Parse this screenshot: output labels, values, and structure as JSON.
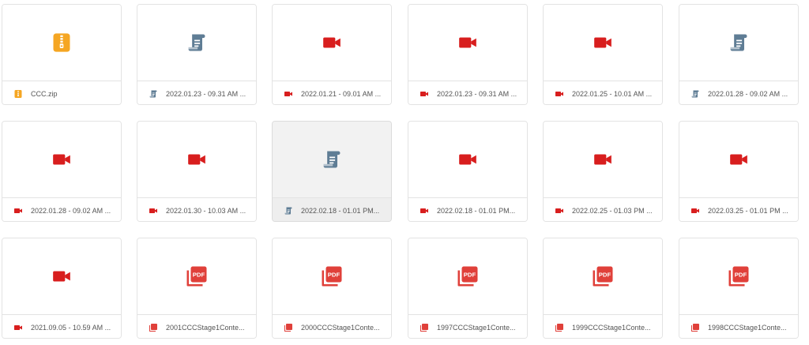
{
  "files": [
    {
      "name": "CCC.zip",
      "type": "zip"
    },
    {
      "name": "2022.01.23 - 09.31 AM ...",
      "type": "doc"
    },
    {
      "name": "2022.01.21 - 09.01 AM ...",
      "type": "video"
    },
    {
      "name": "2022.01.23 - 09.31 AM ...",
      "type": "video"
    },
    {
      "name": "2022.01.25 - 10.01 AM ...",
      "type": "video"
    },
    {
      "name": "2022.01.28 - 09.02 AM ...",
      "type": "doc"
    },
    {
      "name": "2022.01.28 - 09.02 AM ...",
      "type": "video"
    },
    {
      "name": "2022.01.30 - 10.03 AM ...",
      "type": "video"
    },
    {
      "name": "2022.02.18 - 01.01 PM...",
      "type": "doc",
      "hover": true
    },
    {
      "name": "2022.02.18 - 01.01 PM...",
      "type": "video"
    },
    {
      "name": "2022.02.25 - 01.03 PM ...",
      "type": "video"
    },
    {
      "name": "2022.03.25 - 01.01 PM ...",
      "type": "video"
    },
    {
      "name": "2021.09.05 - 10.59 AM ...",
      "type": "video"
    },
    {
      "name": "2001CCCStage1Conte...",
      "type": "pdf"
    },
    {
      "name": "2000CCCStage1Conte...",
      "type": "pdf"
    },
    {
      "name": "1997CCCStage1Conte...",
      "type": "pdf"
    },
    {
      "name": "1999CCCStage1Conte...",
      "type": "pdf"
    },
    {
      "name": "1998CCCStage1Conte...",
      "type": "pdf"
    }
  ],
  "icons": {
    "zip": "zip-file-icon",
    "doc": "document-scroll-icon",
    "video": "video-camera-icon",
    "pdf": "pdf-file-icon"
  },
  "colors": {
    "zip": "#f5a623",
    "doc": "#5f7d95",
    "video": "#d81e1e",
    "pdf": "#e0403a"
  },
  "pdf_badge": "PDF"
}
